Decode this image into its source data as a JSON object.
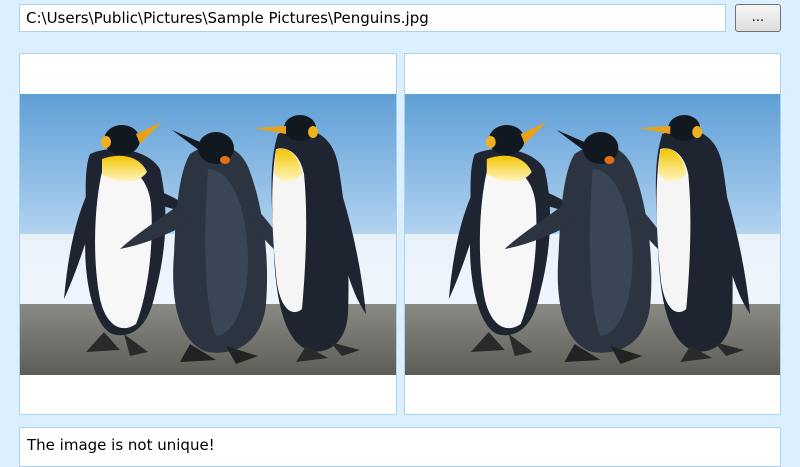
{
  "file_picker": {
    "path_value": "C:\\Users\\Public\\Pictures\\Sample Pictures\\Penguins.jpg",
    "browse_label": "..."
  },
  "images": {
    "left_icon": "penguins-photo",
    "right_icon": "penguins-photo"
  },
  "status": {
    "message": "The image is not unique!"
  },
  "colors": {
    "window_background": "#dcefff",
    "panel_border": "#a9d3ef"
  }
}
